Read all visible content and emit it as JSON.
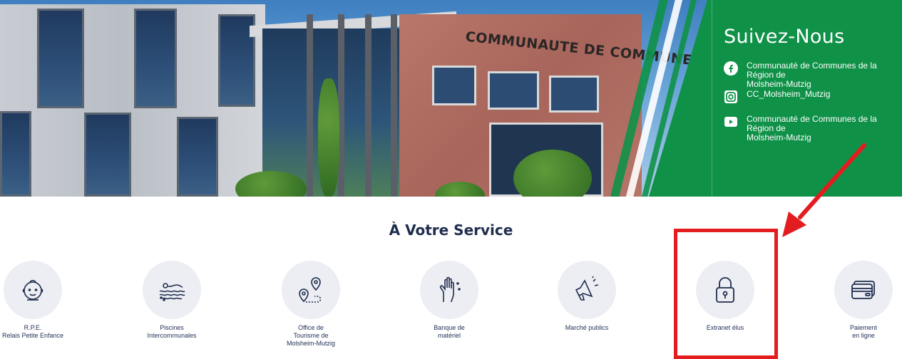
{
  "follow": {
    "title": "Suivez-Nous",
    "items": [
      {
        "icon": "facebook-icon",
        "text": "Communauté de Communes de la Région de\nMolsheim-Mutzig"
      },
      {
        "icon": "instagram-icon",
        "text": "CC_Molsheim_Mutzig"
      },
      {
        "icon": "youtube-icon",
        "text": "Communauté de Communes de la Région de\nMolsheim-Mutzig"
      }
    ]
  },
  "hero": {
    "sign": "COMMUNAUTE DE COMMUNES"
  },
  "services": {
    "title": "À Votre Service",
    "items": [
      {
        "icon": "baby-face-icon",
        "label": "R.P.E.\nRelais Petite Enfance"
      },
      {
        "icon": "swimmer-icon",
        "label": "Piscines\nIntercommunales"
      },
      {
        "icon": "map-route-icon",
        "label": "Office de\nTourisme de\nMolsheim-Mutzig"
      },
      {
        "icon": "raised-hand-icon",
        "label": "Banque de\nmatériel"
      },
      {
        "icon": "megaphone-icon",
        "label": "Marché publics"
      },
      {
        "icon": "padlock-icon",
        "label": "Extranet élus"
      },
      {
        "icon": "credit-card-icon",
        "label": "Paiement\nen ligne"
      }
    ]
  },
  "colors": {
    "green": "#109148",
    "navy": "#1f2d4d",
    "annotation_red": "#e31d1f",
    "circle_bg": "#eceef3"
  }
}
